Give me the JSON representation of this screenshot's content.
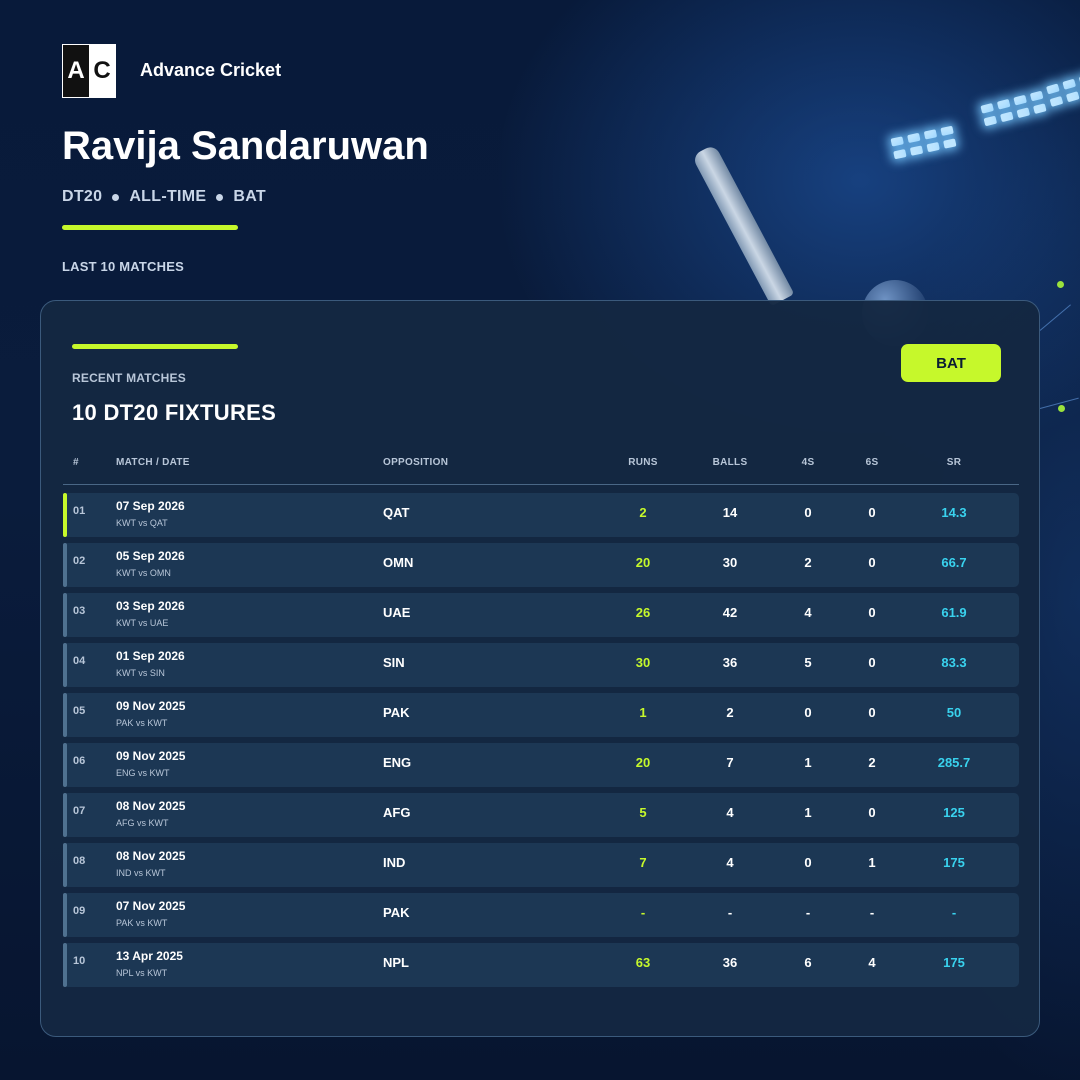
{
  "brand": {
    "logo_left": "A",
    "logo_right": "C",
    "name": "Advance Cricket"
  },
  "player": {
    "name": "Ravija Sandaruwan"
  },
  "meta": [
    "DT20",
    "ALL-TIME",
    "BAT"
  ],
  "section_label": "LAST 10 MATCHES",
  "card": {
    "kicker": "RECENT MATCHES",
    "title": "10 DT20 FIXTURES",
    "button_label": "BAT"
  },
  "columns": [
    "#",
    "MATCH / DATE",
    "OPPOSITION",
    "RUNS",
    "BALLS",
    "4S",
    "6S",
    "SR"
  ],
  "matches": [
    {
      "num": "01",
      "date": "07 Sep 2026",
      "teams": "KWT vs QAT",
      "opp": "QAT",
      "runs": "2",
      "balls": "14",
      "fours": "0",
      "sixes": "0",
      "sr": "14.3",
      "active": true
    },
    {
      "num": "02",
      "date": "05 Sep 2026",
      "teams": "KWT vs OMN",
      "opp": "OMN",
      "runs": "20",
      "balls": "30",
      "fours": "2",
      "sixes": "0",
      "sr": "66.7",
      "active": false
    },
    {
      "num": "03",
      "date": "03 Sep 2026",
      "teams": "KWT vs UAE",
      "opp": "UAE",
      "runs": "26",
      "balls": "42",
      "fours": "4",
      "sixes": "0",
      "sr": "61.9",
      "active": false
    },
    {
      "num": "04",
      "date": "01 Sep 2026",
      "teams": "KWT vs SIN",
      "opp": "SIN",
      "runs": "30",
      "balls": "36",
      "fours": "5",
      "sixes": "0",
      "sr": "83.3",
      "active": false
    },
    {
      "num": "05",
      "date": "09 Nov 2025",
      "teams": "PAK vs KWT",
      "opp": "PAK",
      "runs": "1",
      "balls": "2",
      "fours": "0",
      "sixes": "0",
      "sr": "50",
      "active": false
    },
    {
      "num": "06",
      "date": "09 Nov 2025",
      "teams": "ENG vs KWT",
      "opp": "ENG",
      "runs": "20",
      "balls": "7",
      "fours": "1",
      "sixes": "2",
      "sr": "285.7",
      "active": false
    },
    {
      "num": "07",
      "date": "08 Nov 2025",
      "teams": "AFG vs KWT",
      "opp": "AFG",
      "runs": "5",
      "balls": "4",
      "fours": "1",
      "sixes": "0",
      "sr": "125",
      "active": false
    },
    {
      "num": "08",
      "date": "08 Nov 2025",
      "teams": "IND vs KWT",
      "opp": "IND",
      "runs": "7",
      "balls": "4",
      "fours": "0",
      "sixes": "1",
      "sr": "175",
      "active": false
    },
    {
      "num": "09",
      "date": "07 Nov 2025",
      "teams": "PAK vs KWT",
      "opp": "PAK",
      "runs": "-",
      "balls": "-",
      "fours": "-",
      "sixes": "-",
      "sr": "-",
      "active": false
    },
    {
      "num": "10",
      "date": "13 Apr 2025",
      "teams": "NPL vs KWT",
      "opp": "NPL",
      "runs": "63",
      "balls": "36",
      "fours": "6",
      "sixes": "4",
      "sr": "175",
      "active": false
    }
  ],
  "colors": {
    "accent": "#c6f82b",
    "sr": "#39d2ee",
    "card": "#14284a",
    "background": "#081a3a"
  }
}
